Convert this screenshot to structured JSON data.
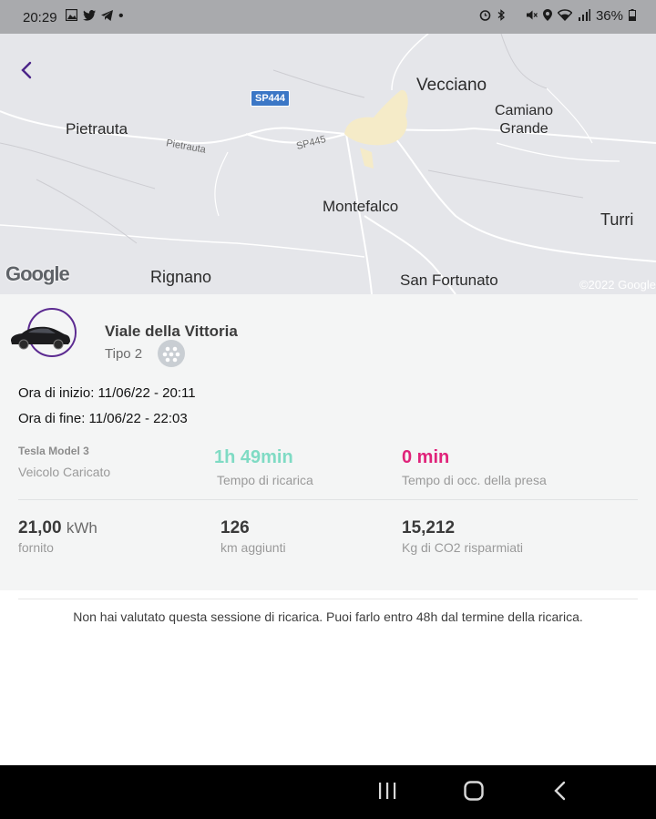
{
  "status_bar": {
    "time": "20:29",
    "battery": "36%"
  },
  "map": {
    "places": {
      "vecciano": "Vecciano",
      "camiano_grande": "Camiano\nGrande",
      "pietrauta": "Pietrauta",
      "montefalco": "Montefalco",
      "turri": "Turri",
      "rignano": "Rignano",
      "san_fortunato": "San Fortunato"
    },
    "roads": {
      "sp444": "SP444",
      "sp445": "SP445",
      "pietrauta_road": "Pietrauta"
    },
    "attribution": "Google",
    "copyright": "©2022 Google"
  },
  "session": {
    "station_name": "Viale della Vittoria",
    "plug_type": "Tipo 2",
    "start_label": "Ora di inizio: 11/06/22 - 20:11",
    "end_label": "Ora di fine: 11/06/22 - 22:03",
    "vehicle_model": "Tesla Model 3",
    "vehicle_status": "Veicolo Caricato",
    "charge_time": "1h 49min",
    "charge_time_label": "Tempo di ricarica",
    "occupancy_time": "0 min",
    "occupancy_label": "Tempo di occ. della presa",
    "energy_value": "21,00",
    "energy_unit": "kWh",
    "energy_label": "fornito",
    "km_value": "126",
    "km_label": "km aggiunti",
    "co2_value": "15,212",
    "co2_label": "Kg di CO2 risparmiati"
  },
  "rating_note": "Non hai valutato questa sessione di ricarica. Puoi farlo entro 48h dal termine della ricarica.",
  "colors": {
    "accent": "#5c2b91",
    "charge_time": "#7fdbc4",
    "occupancy": "#e0237a"
  }
}
